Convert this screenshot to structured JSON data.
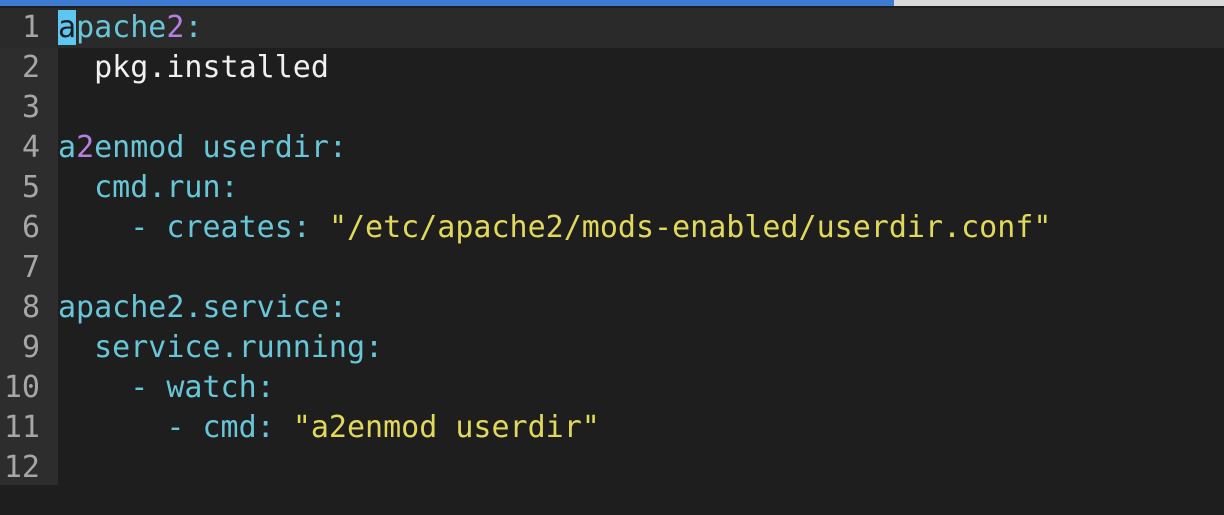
{
  "topbar": {
    "progress": 0.73
  },
  "lines": [
    {
      "n": "1",
      "tokens": [
        {
          "t": "a",
          "c": "cursor"
        },
        {
          "t": "pache",
          "c": "t-key"
        },
        {
          "t": "2",
          "c": "t-num"
        },
        {
          "t": ":",
          "c": "t-punct"
        }
      ]
    },
    {
      "n": "2",
      "tokens": [
        {
          "t": "  pkg.installed",
          "c": "t-plain"
        }
      ]
    },
    {
      "n": "3",
      "tokens": []
    },
    {
      "n": "4",
      "tokens": [
        {
          "t": "a",
          "c": "t-key"
        },
        {
          "t": "2",
          "c": "t-num"
        },
        {
          "t": "enmod userdir:",
          "c": "t-key"
        }
      ]
    },
    {
      "n": "5",
      "tokens": [
        {
          "t": "  cmd.run:",
          "c": "t-key"
        }
      ]
    },
    {
      "n": "6",
      "tokens": [
        {
          "t": "    - ",
          "c": "t-key"
        },
        {
          "t": "creates: ",
          "c": "t-key"
        },
        {
          "t": "\"/etc/apache2/mods-enabled/userdir.conf\"",
          "c": "t-str"
        }
      ]
    },
    {
      "n": "7",
      "tokens": []
    },
    {
      "n": "8",
      "tokens": [
        {
          "t": "apache2.service:",
          "c": "t-key"
        }
      ]
    },
    {
      "n": "9",
      "tokens": [
        {
          "t": "  service.running:",
          "c": "t-key"
        }
      ]
    },
    {
      "n": "10",
      "tokens": [
        {
          "t": "    - ",
          "c": "t-key"
        },
        {
          "t": "watch:",
          "c": "t-key"
        }
      ]
    },
    {
      "n": "11",
      "tokens": [
        {
          "t": "      - ",
          "c": "t-key"
        },
        {
          "t": "cmd: ",
          "c": "t-key"
        },
        {
          "t": "\"a2enmod userdir\"",
          "c": "t-str"
        }
      ]
    },
    {
      "n": "12",
      "tokens": []
    }
  ]
}
